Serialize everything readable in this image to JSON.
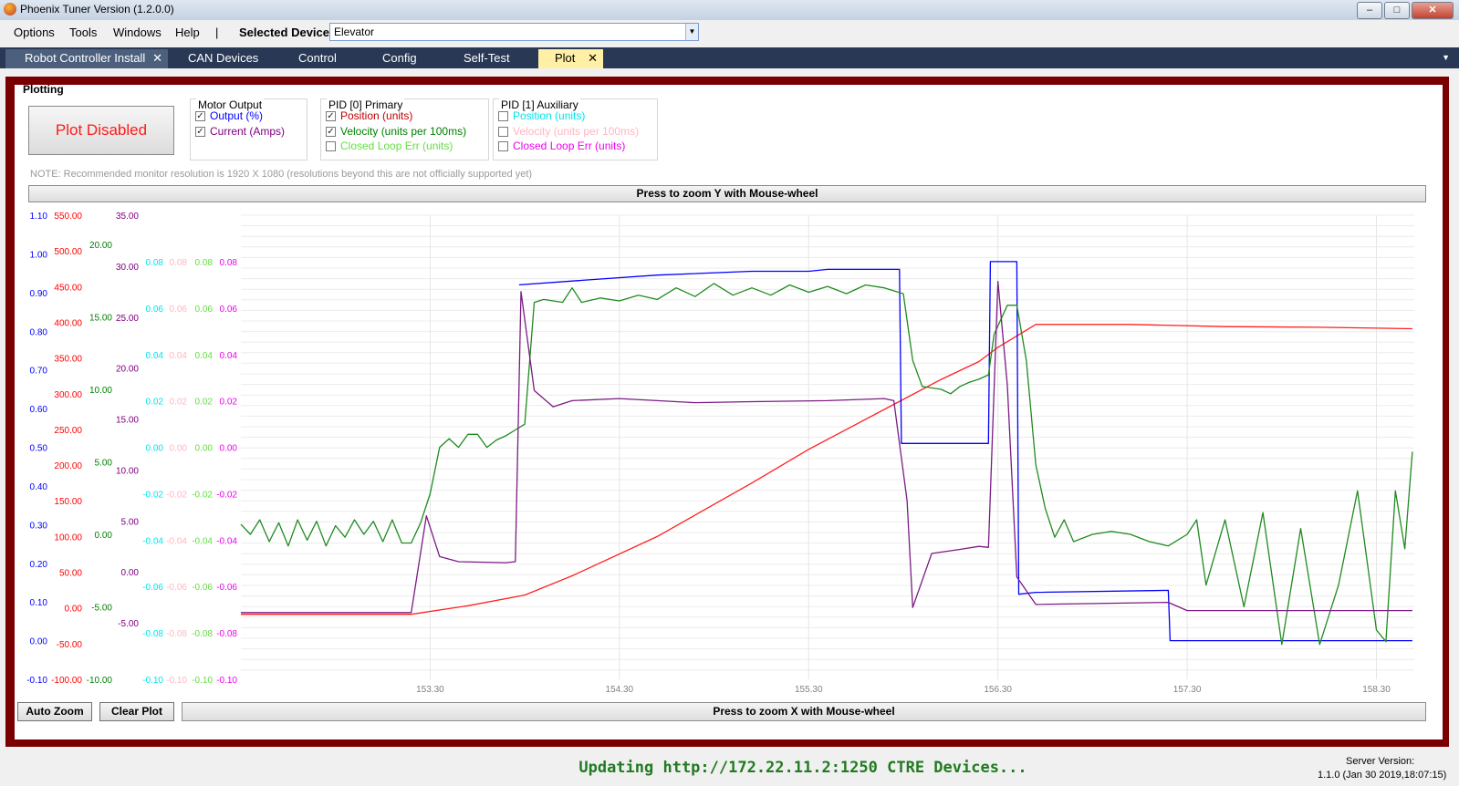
{
  "window": {
    "title": "Phoenix Tuner Version (1.2.0.0)"
  },
  "menu": {
    "items": [
      "Options",
      "Tools",
      "Windows",
      "Help",
      "|"
    ],
    "device_label": "Selected Device:",
    "device_value": "Elevator"
  },
  "tabs": [
    "Robot Controller Install",
    "CAN Devices",
    "Control",
    "Config",
    "Self-Test",
    "Plot"
  ],
  "active_tab": "Plot",
  "panel": {
    "title": "Plotting",
    "plot_button": "Plot Disabled",
    "note": "NOTE: Recommended monitor resolution is 1920 X 1080 (resolutions beyond this are not officially supported yet)",
    "zoom_y": "Press to zoom Y with Mouse-wheel",
    "zoom_x": "Press to zoom X with Mouse-wheel",
    "auto_zoom": "Auto Zoom",
    "clear_plot": "Clear Plot"
  },
  "groups": [
    {
      "title": "Motor Output",
      "items": [
        {
          "label": "Output (%)",
          "checked": true,
          "color": "#0000ff"
        },
        {
          "label": "Current (Amps)",
          "checked": true,
          "color": "#800080"
        }
      ]
    },
    {
      "title": "PID [0] Primary",
      "items": [
        {
          "label": "Position (units)",
          "checked": true,
          "color": "#c00000"
        },
        {
          "label": "Velocity (units per 100ms)",
          "checked": true,
          "color": "#008000"
        },
        {
          "label": "Closed Loop Err (units)",
          "checked": false,
          "color": "#66dd44"
        }
      ]
    },
    {
      "title": "PID [1] Auxiliary",
      "items": [
        {
          "label": "Position (units)",
          "checked": false,
          "color": "#00e5ee"
        },
        {
          "label": "Velocity (units per 100ms)",
          "checked": false,
          "color": "#ffb6c1"
        },
        {
          "label": "Closed Loop Err (units)",
          "checked": false,
          "color": "#ee00ee"
        }
      ]
    }
  ],
  "status": {
    "text": "Updating http://172.22.11.2:1250 CTRE Devices...",
    "server_label": "Server Version:",
    "server_value": "1.1.0 (Jan 30 2019,18:07:15)"
  },
  "chart_data": {
    "type": "line",
    "x_ticks": [
      "153.30",
      "154.30",
      "155.30",
      "156.30",
      "157.30",
      "158.30"
    ],
    "xlim": [
      152.3,
      158.5
    ],
    "grid": true,
    "axes": [
      {
        "name": "output",
        "color": "#0000ff",
        "min": -0.1,
        "max": 1.1,
        "ticks": [
          "1.10",
          "1.00",
          "0.90",
          "0.80",
          "0.70",
          "0.60",
          "0.50",
          "0.40",
          "0.30",
          "0.20",
          "0.10",
          "0.00",
          "-0.10"
        ]
      },
      {
        "name": "position",
        "color": "#ff0000",
        "min": -100,
        "max": 550,
        "ticks": [
          "550.00",
          "500.00",
          "450.00",
          "400.00",
          "350.00",
          "300.00",
          "250.00",
          "200.00",
          "150.00",
          "100.00",
          "50.00",
          "0.00",
          "-50.00",
          "-100.00"
        ]
      },
      {
        "name": "velocity",
        "color": "#008000",
        "min": -10,
        "max": 20,
        "ticks": [
          "20.00",
          "15.00",
          "10.00",
          "5.00",
          "0.00",
          "-5.00",
          "-10.00"
        ]
      },
      {
        "name": "current",
        "color": "#800080",
        "min": -5,
        "max": 35,
        "ticks": [
          "35.00",
          "30.00",
          "25.00",
          "20.00",
          "15.00",
          "10.00",
          "5.00",
          "0.00",
          "-5.00"
        ]
      },
      {
        "name": "aux_position",
        "color": "#00e5ee",
        "min": -0.1,
        "max": 0.1,
        "ticks": [
          "0.08",
          "0.06",
          "0.04",
          "0.02",
          "0.00",
          "-0.02",
          "-0.04",
          "-0.06",
          "-0.08",
          "-0.10"
        ]
      },
      {
        "name": "aux_velocity",
        "color": "#ffb6c1",
        "min": -0.1,
        "max": 0.1,
        "ticks": [
          "0.08",
          "0.06",
          "0.04",
          "0.02",
          "0.00",
          "-0.02",
          "-0.04",
          "-0.06",
          "-0.08",
          "-0.10"
        ]
      },
      {
        "name": "closed_loop_err",
        "color": "#66dd44",
        "min": -0.1,
        "max": 0.1,
        "ticks": [
          "0.08",
          "0.06",
          "0.04",
          "0.02",
          "0.00",
          "-0.02",
          "-0.04",
          "-0.06",
          "-0.08",
          "-0.10"
        ]
      },
      {
        "name": "aux_closed_loop_err",
        "color": "#ee00ee",
        "min": -0.1,
        "max": 0.1,
        "ticks": [
          "0.08",
          "0.06",
          "0.04",
          "0.02",
          "0.00",
          "-0.02",
          "-0.04",
          "-0.06",
          "-0.08",
          "-0.10"
        ]
      }
    ],
    "series": [
      {
        "name": "Position (units)",
        "axis": "position",
        "color": "#ff2020",
        "points": [
          [
            152.3,
            -9
          ],
          [
            153.2,
            -9
          ],
          [
            153.5,
            3
          ],
          [
            153.8,
            18
          ],
          [
            154.05,
            45
          ],
          [
            154.5,
            100
          ],
          [
            155.0,
            175
          ],
          [
            155.3,
            222
          ],
          [
            155.5,
            250
          ],
          [
            155.8,
            292
          ],
          [
            156.0,
            320
          ],
          [
            156.2,
            345
          ],
          [
            156.3,
            365
          ],
          [
            156.5,
            397
          ],
          [
            157.0,
            397
          ],
          [
            157.5,
            394
          ],
          [
            158.0,
            393
          ],
          [
            158.49,
            391
          ]
        ]
      },
      {
        "name": "Output (%)",
        "axis": "output",
        "color": "#0000ff",
        "points": [
          [
            153.77,
            0.92
          ],
          [
            154.2,
            0.935
          ],
          [
            154.5,
            0.945
          ],
          [
            155.0,
            0.955
          ],
          [
            155.3,
            0.955
          ],
          [
            155.4,
            0.96
          ],
          [
            155.7,
            0.96
          ],
          [
            155.78,
            0.96
          ],
          [
            155.79,
            0.51
          ],
          [
            155.9,
            0.51
          ],
          [
            156.2,
            0.51
          ],
          [
            156.25,
            0.51
          ],
          [
            156.26,
            0.98
          ],
          [
            156.4,
            0.98
          ],
          [
            156.41,
            0.12
          ],
          [
            156.5,
            0.125
          ],
          [
            157.2,
            0.13
          ],
          [
            157.21,
            0.0
          ],
          [
            157.8,
            0.0
          ],
          [
            158.49,
            0.0
          ]
        ]
      },
      {
        "name": "Velocity (units per 100ms)",
        "axis": "velocity",
        "color": "#208a20",
        "points": [
          [
            152.3,
            0.7
          ],
          [
            152.35,
            0.0
          ],
          [
            152.4,
            1.0
          ],
          [
            152.45,
            -0.5
          ],
          [
            152.5,
            0.8
          ],
          [
            152.55,
            -0.8
          ],
          [
            152.6,
            1.0
          ],
          [
            152.65,
            -0.4
          ],
          [
            152.7,
            0.9
          ],
          [
            152.75,
            -0.8
          ],
          [
            152.8,
            0.6
          ],
          [
            152.85,
            -0.2
          ],
          [
            152.9,
            1.0
          ],
          [
            152.95,
            0.0
          ],
          [
            153.0,
            0.9
          ],
          [
            153.05,
            -0.5
          ],
          [
            153.1,
            1.0
          ],
          [
            153.15,
            -0.6
          ],
          [
            153.2,
            -0.6
          ],
          [
            153.25,
            0.8
          ],
          [
            153.3,
            2.8
          ],
          [
            153.35,
            6.0
          ],
          [
            153.4,
            6.6
          ],
          [
            153.45,
            6.0
          ],
          [
            153.5,
            6.9
          ],
          [
            153.55,
            6.9
          ],
          [
            153.6,
            6.0
          ],
          [
            153.65,
            6.5
          ],
          [
            153.7,
            6.8
          ],
          [
            153.75,
            7.2
          ],
          [
            153.8,
            7.6
          ],
          [
            153.85,
            16.0
          ],
          [
            153.9,
            16.2
          ],
          [
            154.0,
            16.0
          ],
          [
            154.05,
            17.0
          ],
          [
            154.1,
            16.0
          ],
          [
            154.2,
            16.3
          ],
          [
            154.3,
            16.1
          ],
          [
            154.4,
            16.5
          ],
          [
            154.5,
            16.2
          ],
          [
            154.6,
            17.0
          ],
          [
            154.7,
            16.4
          ],
          [
            154.8,
            17.3
          ],
          [
            154.9,
            16.5
          ],
          [
            155.0,
            17.0
          ],
          [
            155.1,
            16.5
          ],
          [
            155.2,
            17.2
          ],
          [
            155.3,
            16.7
          ],
          [
            155.4,
            17.1
          ],
          [
            155.5,
            16.6
          ],
          [
            155.6,
            17.2
          ],
          [
            155.7,
            17.0
          ],
          [
            155.8,
            16.6
          ],
          [
            155.85,
            12.0
          ],
          [
            155.9,
            10.2
          ],
          [
            156.0,
            10.0
          ],
          [
            156.05,
            9.7
          ],
          [
            156.1,
            10.2
          ],
          [
            156.15,
            10.5
          ],
          [
            156.2,
            10.7
          ],
          [
            156.25,
            11.0
          ],
          [
            156.28,
            13.8
          ],
          [
            156.35,
            15.8
          ],
          [
            156.4,
            15.8
          ],
          [
            156.45,
            12.0
          ],
          [
            156.5,
            4.8
          ],
          [
            156.55,
            1.8
          ],
          [
            156.6,
            -0.2
          ],
          [
            156.65,
            1.0
          ],
          [
            156.7,
            -0.5
          ],
          [
            156.8,
            0.0
          ],
          [
            156.9,
            0.2
          ],
          [
            157.0,
            0.0
          ],
          [
            157.1,
            -0.5
          ],
          [
            157.2,
            -0.8
          ],
          [
            157.3,
            0.0
          ],
          [
            157.35,
            1.0
          ],
          [
            157.4,
            -3.5
          ],
          [
            157.5,
            1.0
          ],
          [
            157.6,
            -5.0
          ],
          [
            157.7,
            1.5
          ],
          [
            157.8,
            -7.6
          ],
          [
            157.9,
            0.4
          ],
          [
            158.0,
            -7.6
          ],
          [
            158.1,
            -3.5
          ],
          [
            158.2,
            3.0
          ],
          [
            158.3,
            -6.6
          ],
          [
            158.35,
            -7.4
          ],
          [
            158.4,
            3.0
          ],
          [
            158.45,
            -1.0
          ],
          [
            158.49,
            5.7
          ]
        ]
      },
      {
        "name": "Current (Amps)",
        "axis": "current",
        "color": "#7b1b84",
        "points": [
          [
            152.3,
            -4.0
          ],
          [
            153.2,
            -4.0
          ],
          [
            153.28,
            5.5
          ],
          [
            153.35,
            1.5
          ],
          [
            153.45,
            1.0
          ],
          [
            153.7,
            0.9
          ],
          [
            153.75,
            1.0
          ],
          [
            153.78,
            27.5
          ],
          [
            153.85,
            17.8
          ],
          [
            153.95,
            16.2
          ],
          [
            154.05,
            16.8
          ],
          [
            154.3,
            17.0
          ],
          [
            154.7,
            16.6
          ],
          [
            155.0,
            16.7
          ],
          [
            155.4,
            16.8
          ],
          [
            155.7,
            17.0
          ],
          [
            155.75,
            16.8
          ],
          [
            155.82,
            7.0
          ],
          [
            155.85,
            -3.5
          ],
          [
            155.95,
            1.8
          ],
          [
            156.1,
            2.2
          ],
          [
            156.2,
            2.5
          ],
          [
            156.25,
            2.4
          ],
          [
            156.3,
            28.5
          ],
          [
            156.35,
            18.3
          ],
          [
            156.4,
            -0.5
          ],
          [
            156.5,
            -3.2
          ],
          [
            157.2,
            -3.0
          ],
          [
            157.3,
            -3.8
          ],
          [
            158.49,
            -3.8
          ]
        ]
      }
    ]
  }
}
